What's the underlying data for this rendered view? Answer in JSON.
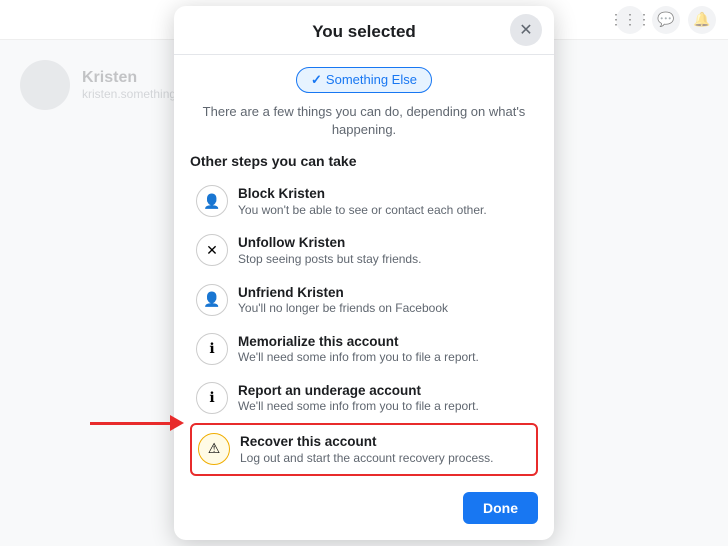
{
  "nav": {
    "icons": [
      "⋮⋮⋮",
      "💬",
      "🔔"
    ]
  },
  "profile": {
    "name": "Kristen",
    "sub": "kristen.something@example.com"
  },
  "modal": {
    "title": "You selected",
    "close_label": "✕",
    "badge": {
      "check": "✓",
      "label": "Something Else"
    },
    "subtitle": "There are a few things you can do, depending on what's happening.",
    "section_title": "Other steps you can take",
    "actions": [
      {
        "icon": "👤",
        "icon_type": "normal",
        "label": "Block Kristen",
        "desc": "You won't be able to see or contact each other.",
        "highlighted": false
      },
      {
        "icon": "✕",
        "icon_type": "normal",
        "label": "Unfollow Kristen",
        "desc": "Stop seeing posts but stay friends.",
        "highlighted": false
      },
      {
        "icon": "👤",
        "icon_type": "normal",
        "label": "Unfriend Kristen",
        "desc": "You'll no longer be friends on Facebook",
        "highlighted": false
      },
      {
        "icon": "ℹ",
        "icon_type": "normal",
        "label": "Memorialize this account",
        "desc": "We'll need some info from you to file a report.",
        "highlighted": false
      },
      {
        "icon": "ℹ",
        "icon_type": "normal",
        "label": "Report an underage account",
        "desc": "We'll need some info from you to file a report.",
        "highlighted": false
      },
      {
        "icon": "⚠",
        "icon_type": "warning",
        "label": "Recover this account",
        "desc": "Log out and start the account recovery process.",
        "highlighted": true
      }
    ],
    "done_label": "Done"
  }
}
